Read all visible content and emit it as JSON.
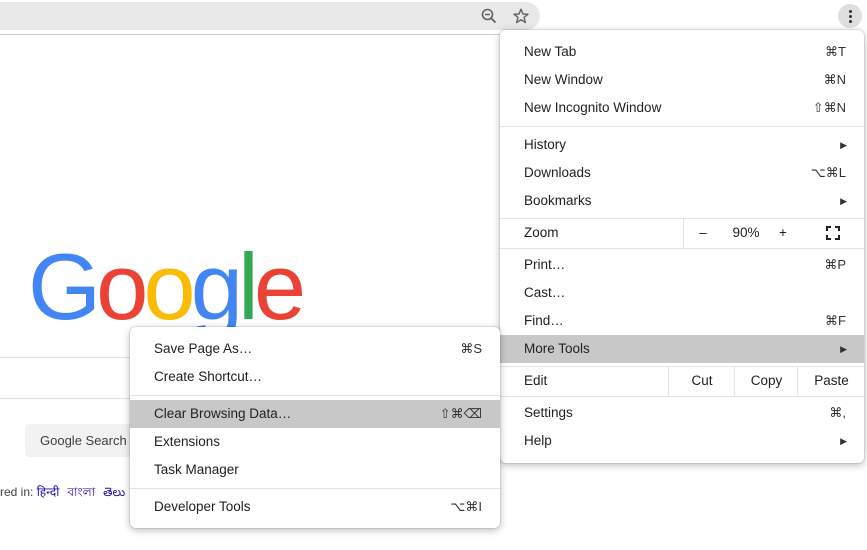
{
  "toolbar": {
    "zoom_icon": "zoom-out-magnifier-icon",
    "bookmark_icon": "star-icon",
    "menu_icon": "three-dot-menu-icon"
  },
  "page": {
    "logo_letters": [
      {
        "ch": "G",
        "color": "#4285F4"
      },
      {
        "ch": "o",
        "color": "#EA4335"
      },
      {
        "ch": "o",
        "color": "#FBBC05"
      },
      {
        "ch": "g",
        "color": "#4285F4"
      },
      {
        "ch": "l",
        "color": "#34A853"
      },
      {
        "ch": "e",
        "color": "#EA4335"
      }
    ],
    "google_search_button": "Google Search",
    "offered_in": "red in:",
    "languages": [
      "हिन्दी",
      "বাংলা",
      "తెలు"
    ]
  },
  "main_menu": {
    "new_tab": {
      "label": "New Tab",
      "shortcut": "⌘T"
    },
    "new_window": {
      "label": "New Window",
      "shortcut": "⌘N"
    },
    "new_incognito": {
      "label": "New Incognito Window",
      "shortcut": "⇧⌘N"
    },
    "history": {
      "label": "History"
    },
    "downloads": {
      "label": "Downloads",
      "shortcut": "⌥⌘L"
    },
    "bookmarks": {
      "label": "Bookmarks"
    },
    "zoom": {
      "label": "Zoom",
      "minus": "–",
      "value": "90%",
      "plus": "+"
    },
    "print": {
      "label": "Print…",
      "shortcut": "⌘P"
    },
    "cast": {
      "label": "Cast…"
    },
    "find": {
      "label": "Find…",
      "shortcut": "⌘F"
    },
    "more_tools": {
      "label": "More Tools"
    },
    "edit": {
      "label": "Edit",
      "cut": "Cut",
      "copy": "Copy",
      "paste": "Paste"
    },
    "settings": {
      "label": "Settings",
      "shortcut": "⌘,"
    },
    "help": {
      "label": "Help"
    },
    "submenu_arrow": "▶"
  },
  "sub_menu": {
    "save_page": {
      "label": "Save Page As…",
      "shortcut": "⌘S"
    },
    "create_shortcut": {
      "label": "Create Shortcut…"
    },
    "clear_browsing": {
      "label": "Clear Browsing Data…",
      "shortcut": "⇧⌘⌫"
    },
    "extensions": {
      "label": "Extensions"
    },
    "task_manager": {
      "label": "Task Manager"
    },
    "developer_tools": {
      "label": "Developer Tools",
      "shortcut": "⌥⌘I"
    }
  },
  "colors": {
    "highlight": "#c8c8c8",
    "link": "#1a0dab"
  }
}
